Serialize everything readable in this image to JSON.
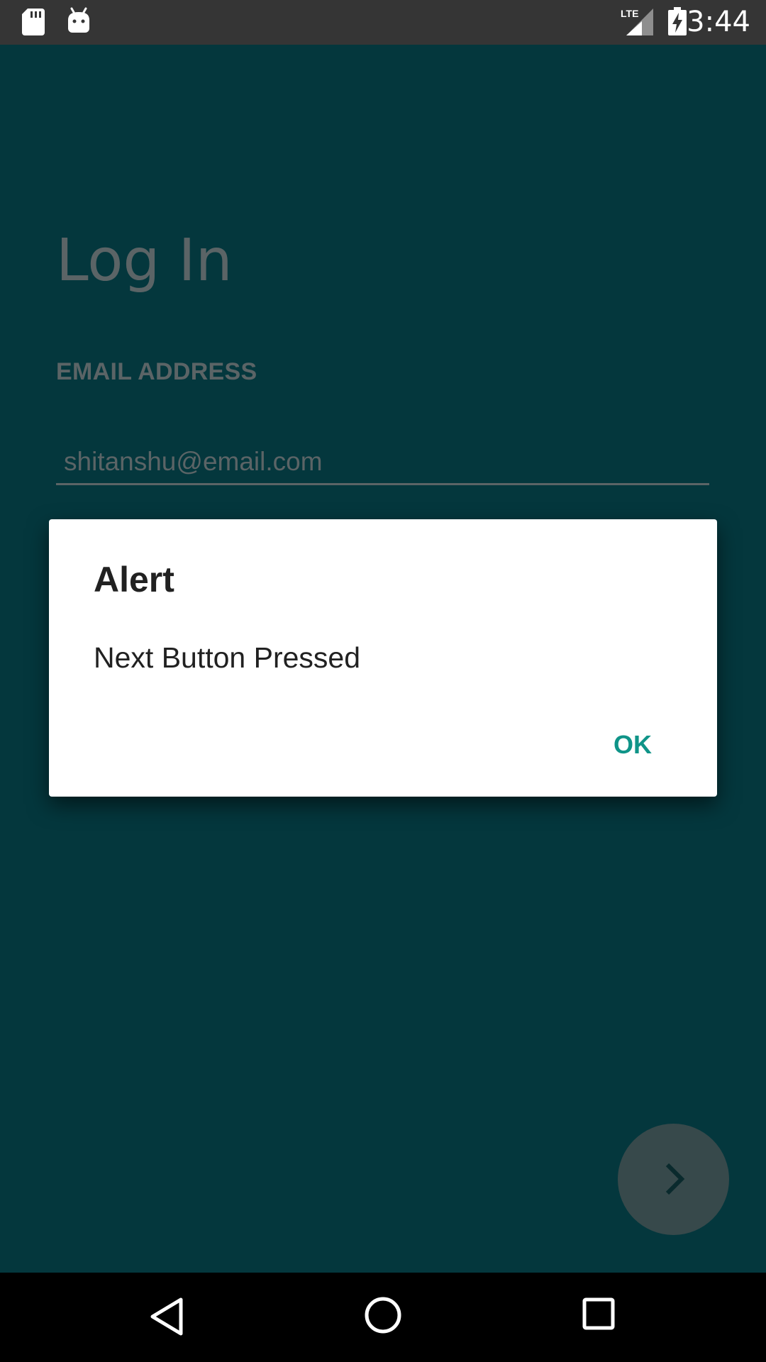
{
  "status_bar": {
    "time": "3:44",
    "network_label": "LTE",
    "left_icons": [
      "sd-card-icon",
      "android-icon"
    ],
    "right_icons": [
      "lte-signal-icon",
      "battery-charging-icon"
    ]
  },
  "login": {
    "title": "Log In",
    "email_label": "EMAIL ADDRESS",
    "email_value": "shitanshu@email.com",
    "next_icon": "chevron-right-icon"
  },
  "dialog": {
    "title": "Alert",
    "message": "Next Button Pressed",
    "ok_label": "OK"
  },
  "nav_bar": {
    "buttons": [
      "back-icon",
      "home-icon",
      "recents-icon"
    ]
  },
  "colors": {
    "app_background": "#04373d",
    "dialog_accent": "#0f9488",
    "status_bar": "#353535"
  }
}
